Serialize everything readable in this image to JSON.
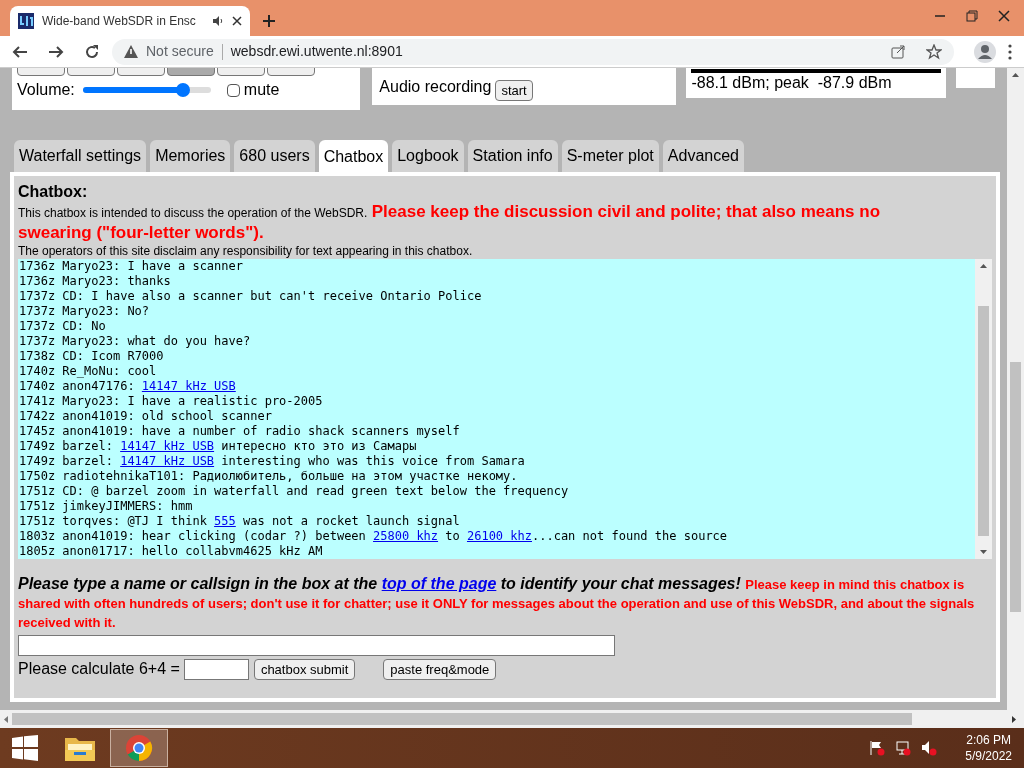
{
  "browser": {
    "tab_title": "Wide-band WebSDR in Ensc",
    "security": "Not secure",
    "url": "websdr.ewi.utwente.nl:8901"
  },
  "controls": {
    "modes": [
      {
        "selected": false
      },
      {
        "selected": false
      },
      {
        "selected": false
      },
      {
        "selected": true
      },
      {
        "selected": false
      },
      {
        "selected": false
      }
    ],
    "volume_label": "Volume:",
    "volume": {
      "level": 0.78
    },
    "mute": {
      "label": "mute",
      "checked": false
    },
    "recording_label": "Audio recording",
    "recording_button": "start",
    "smeter": "-88.1 dBm; peak  -87.9 dBm"
  },
  "tabs": [
    {
      "label": "Waterfall settings",
      "selected": false
    },
    {
      "label": "Memories",
      "selected": false
    },
    {
      "label": "680 users",
      "selected": false
    },
    {
      "label": "Chatbox",
      "selected": true
    },
    {
      "label": "Logbook",
      "selected": false
    },
    {
      "label": "Station info",
      "selected": false
    },
    {
      "label": "S-meter plot",
      "selected": false
    },
    {
      "label": "Advanced",
      "selected": false
    }
  ],
  "chatbox": {
    "heading": "Chatbox:",
    "intro": "This chatbox is intended to discuss the operation of the WebSDR.",
    "warning": "Please keep the discussion civil and polite; that also means no swearing (\"four-letter words\").",
    "disclaimer": "The operators of this site disclaim any responsibility for text appearing in this chatbox.",
    "messages": [
      {
        "time": "1736z",
        "user": "Maryo23:",
        "parts": [
          {
            "kind": "text",
            "text": "I have a scanner"
          }
        ]
      },
      {
        "time": "1736z",
        "user": "Maryo23:",
        "parts": [
          {
            "kind": "text",
            "text": "thanks"
          }
        ]
      },
      {
        "time": "1737z",
        "user": "CD:",
        "parts": [
          {
            "kind": "text",
            "text": "I have also a scanner but can't receive Ontario Police"
          }
        ]
      },
      {
        "time": "1737z",
        "user": "Maryo23:",
        "parts": [
          {
            "kind": "text",
            "text": "No?"
          }
        ]
      },
      {
        "time": "1737z",
        "user": "CD:",
        "parts": [
          {
            "kind": "text",
            "text": "No"
          }
        ]
      },
      {
        "time": "1737z",
        "user": "Maryo23:",
        "parts": [
          {
            "kind": "text",
            "text": "what do you have?"
          }
        ]
      },
      {
        "time": "1738z",
        "user": "CD:",
        "parts": [
          {
            "kind": "text",
            "text": "Icom R7000"
          }
        ]
      },
      {
        "time": "1740z",
        "user": "Re_MoNu:",
        "parts": [
          {
            "kind": "text",
            "text": "cool"
          }
        ]
      },
      {
        "time": "1740z",
        "user": "anon47176:",
        "parts": [
          {
            "kind": "link",
            "text": "14147 kHz USB"
          }
        ]
      },
      {
        "time": "1741z",
        "user": "Maryo23:",
        "parts": [
          {
            "kind": "text",
            "text": "I have a realistic pro-2005"
          }
        ]
      },
      {
        "time": "1742z",
        "user": "anon41019:",
        "parts": [
          {
            "kind": "text",
            "text": "old school scanner"
          }
        ]
      },
      {
        "time": "1745z",
        "user": "anon41019:",
        "parts": [
          {
            "kind": "text",
            "text": "have a number of radio shack scanners myself"
          }
        ]
      },
      {
        "time": "1749z",
        "user": "barzel:",
        "parts": [
          {
            "kind": "link",
            "text": "14147 kHz USB"
          },
          {
            "kind": "text",
            "text": " интересно кто это из Самары"
          }
        ]
      },
      {
        "time": "1749z",
        "user": "barzel:",
        "parts": [
          {
            "kind": "link",
            "text": "14147 kHz USB"
          },
          {
            "kind": "text",
            "text": " interesting who was this voice from Samara"
          }
        ]
      },
      {
        "time": "1750z",
        "user": "radiotehnikaT101:",
        "parts": [
          {
            "kind": "text",
            "text": "Радиолюбитель, больше на этом участке некому."
          }
        ]
      },
      {
        "time": "1751z",
        "user": "CD:",
        "parts": [
          {
            "kind": "text",
            "text": "@ barzel zoom in waterfall and read green text below the frequency"
          }
        ]
      },
      {
        "time": "1751z",
        "user": "jimkeyJIMMERS:",
        "parts": [
          {
            "kind": "text",
            "text": "hmm"
          }
        ]
      },
      {
        "time": "1751z",
        "user": "torqves:",
        "parts": [
          {
            "kind": "text",
            "text": "@TJ I think "
          },
          {
            "kind": "link",
            "text": "555"
          },
          {
            "kind": "text",
            "text": " was not a rocket launch signal"
          }
        ]
      },
      {
        "time": "1803z",
        "user": "anon41019:",
        "parts": [
          {
            "kind": "text",
            "text": "hear clicking (codar ?) between "
          },
          {
            "kind": "link",
            "text": "25800 khz"
          },
          {
            "kind": "text",
            "text": " to "
          },
          {
            "kind": "link",
            "text": "26100 khz"
          },
          {
            "kind": "text",
            "text": "...can not found the source"
          }
        ]
      },
      {
        "time": "1805z",
        "user": "anon01717:",
        "parts": [
          {
            "kind": "text",
            "text": "hello collabvm4625 kHz AM"
          }
        ]
      }
    ],
    "prompt_before": "Please type a name or callsign in the box at the",
    "prompt_link": "top of the page",
    "prompt_after": "to identify your chat messages!",
    "notice": "Please keep in mind this chatbox is shared with often hundreds of users; don't use it for chatter; use it ONLY for messages about the operation and use of this WebSDR, and about the signals received with it.",
    "captcha_label": "Please calculate 6+4 =",
    "submit_button": "chatbox submit",
    "paste_button": "paste freq&mode"
  },
  "taskbar": {
    "time": "2:06 PM",
    "date": "5/9/2022"
  }
}
